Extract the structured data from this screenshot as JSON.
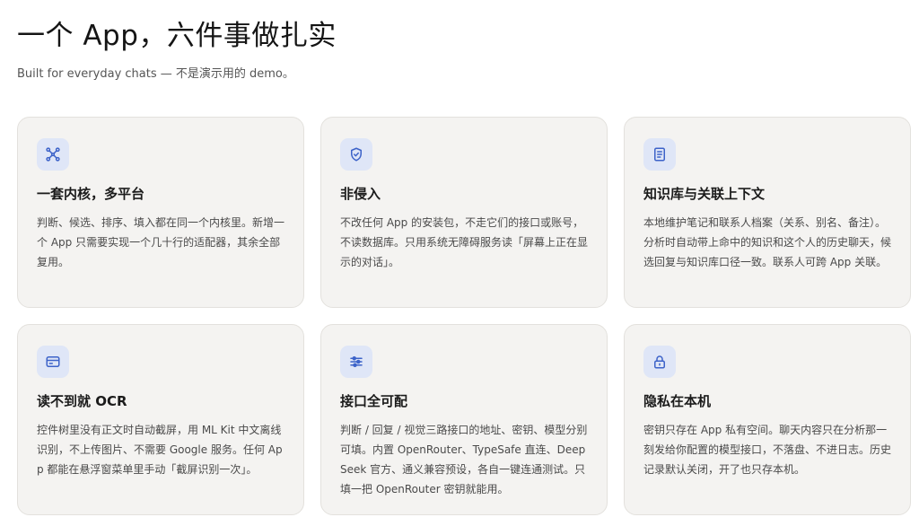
{
  "header": {
    "title": "一个 App，六件事做扎实",
    "subtitle": "Built for everyday chats — 不是演示用的 demo。"
  },
  "colors": {
    "accent": "#3d63c9",
    "card_bg": "#f4f3f1",
    "icon_bg": "#dfe6f7"
  },
  "features": [
    {
      "icon": "network-icon",
      "title": "一套内核，多平台",
      "body": "判断、候选、排序、填入都在同一个内核里。新增一个 App 只需要实现一个几十行的适配器，其余全部复用。"
    },
    {
      "icon": "shield-check-icon",
      "title": "非侵入",
      "body": "不改任何 App 的安装包，不走它们的接口或账号，不读数据库。只用系统无障碍服务读「屏幕上正在显示的对话」。"
    },
    {
      "icon": "document-icon",
      "title": "知识库与关联上下文",
      "body": "本地维护笔记和联系人档案（关系、别名、备注）。分析时自动带上命中的知识和这个人的历史聊天，候选回复与知识库口径一致。联系人可跨 App 关联。"
    },
    {
      "icon": "id-card-icon",
      "title": "读不到就 OCR",
      "body": "控件树里没有正文时自动截屏，用 ML Kit 中文离线识别，不上传图片、不需要 Google 服务。任何 App 都能在悬浮窗菜单里手动「截屏识别一次」。"
    },
    {
      "icon": "sliders-icon",
      "title": "接口全可配",
      "body": "判断 / 回复 / 视觉三路接口的地址、密钥、模型分别可填。内置 OpenRouter、TypeSafe 直连、DeepSeek 官方、通义兼容预设，各自一键连通测试。只填一把 OpenRouter 密钥就能用。"
    },
    {
      "icon": "lock-icon",
      "title": "隐私在本机",
      "body": "密钥只存在 App 私有空间。聊天内容只在分析那一刻发给你配置的模型接口，不落盘、不进日志。历史记录默认关闭，开了也只存本机。"
    }
  ]
}
